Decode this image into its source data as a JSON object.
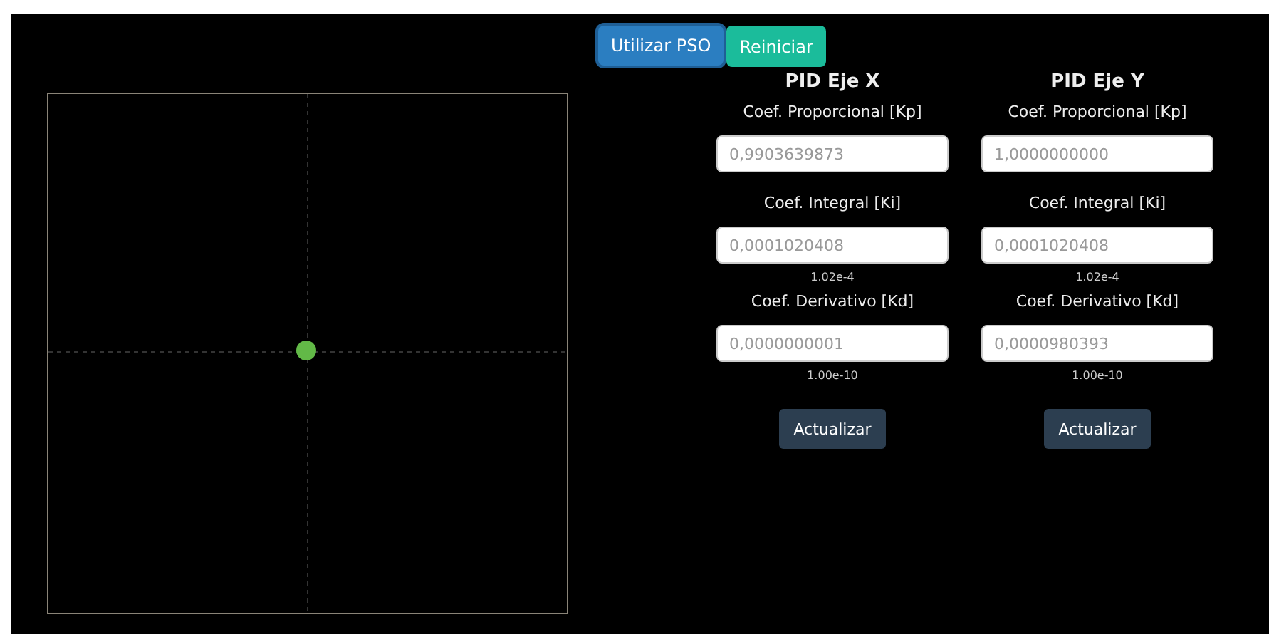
{
  "toolbar": {
    "buttons": [
      {
        "label": "Utilizar PSO",
        "kind": "primary",
        "selected": true
      },
      {
        "label": "Reiniciar",
        "kind": "success",
        "selected": false
      }
    ]
  },
  "controllers": [
    {
      "title": "PID Eje X",
      "fields": [
        {
          "label": "Coef. Proporcional [Kp]",
          "placeholder": "0,9903639873"
        },
        {
          "label": "Coef. Integral [Ki]",
          "placeholder": "0,0001020408",
          "hint": "1.02e-4"
        },
        {
          "label": "Coef. Derivativo [Kd]",
          "placeholder": "0,0000000001",
          "hint": "1.00e-10"
        }
      ],
      "button": "Actualizar"
    },
    {
      "title": "PID Eje Y",
      "fields": [
        {
          "label": "Coef. Proporcional [Kp]",
          "placeholder": "1,0000000000"
        },
        {
          "label": "Coef. Integral [Ki]",
          "placeholder": "0,0001020408",
          "hint": "1.02e-4"
        },
        {
          "label": "Coef. Derivativo [Kd]",
          "placeholder": "0,0000980393",
          "hint": "1.00e-10"
        }
      ],
      "button": "Actualizar"
    }
  ]
}
